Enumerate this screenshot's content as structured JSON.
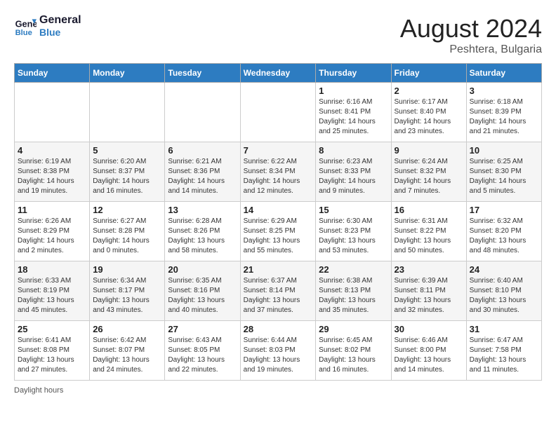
{
  "header": {
    "logo_line1": "General",
    "logo_line2": "Blue",
    "month_year": "August 2024",
    "location": "Peshtera, Bulgaria"
  },
  "days_of_week": [
    "Sunday",
    "Monday",
    "Tuesday",
    "Wednesday",
    "Thursday",
    "Friday",
    "Saturday"
  ],
  "weeks": [
    [
      {
        "day": "",
        "sunrise": "",
        "sunset": "",
        "daylight": ""
      },
      {
        "day": "",
        "sunrise": "",
        "sunset": "",
        "daylight": ""
      },
      {
        "day": "",
        "sunrise": "",
        "sunset": "",
        "daylight": ""
      },
      {
        "day": "",
        "sunrise": "",
        "sunset": "",
        "daylight": ""
      },
      {
        "day": "1",
        "sunrise": "Sunrise: 6:16 AM",
        "sunset": "Sunset: 8:41 PM",
        "daylight": "Daylight: 14 hours and 25 minutes."
      },
      {
        "day": "2",
        "sunrise": "Sunrise: 6:17 AM",
        "sunset": "Sunset: 8:40 PM",
        "daylight": "Daylight: 14 hours and 23 minutes."
      },
      {
        "day": "3",
        "sunrise": "Sunrise: 6:18 AM",
        "sunset": "Sunset: 8:39 PM",
        "daylight": "Daylight: 14 hours and 21 minutes."
      }
    ],
    [
      {
        "day": "4",
        "sunrise": "Sunrise: 6:19 AM",
        "sunset": "Sunset: 8:38 PM",
        "daylight": "Daylight: 14 hours and 19 minutes."
      },
      {
        "day": "5",
        "sunrise": "Sunrise: 6:20 AM",
        "sunset": "Sunset: 8:37 PM",
        "daylight": "Daylight: 14 hours and 16 minutes."
      },
      {
        "day": "6",
        "sunrise": "Sunrise: 6:21 AM",
        "sunset": "Sunset: 8:36 PM",
        "daylight": "Daylight: 14 hours and 14 minutes."
      },
      {
        "day": "7",
        "sunrise": "Sunrise: 6:22 AM",
        "sunset": "Sunset: 8:34 PM",
        "daylight": "Daylight: 14 hours and 12 minutes."
      },
      {
        "day": "8",
        "sunrise": "Sunrise: 6:23 AM",
        "sunset": "Sunset: 8:33 PM",
        "daylight": "Daylight: 14 hours and 9 minutes."
      },
      {
        "day": "9",
        "sunrise": "Sunrise: 6:24 AM",
        "sunset": "Sunset: 8:32 PM",
        "daylight": "Daylight: 14 hours and 7 minutes."
      },
      {
        "day": "10",
        "sunrise": "Sunrise: 6:25 AM",
        "sunset": "Sunset: 8:30 PM",
        "daylight": "Daylight: 14 hours and 5 minutes."
      }
    ],
    [
      {
        "day": "11",
        "sunrise": "Sunrise: 6:26 AM",
        "sunset": "Sunset: 8:29 PM",
        "daylight": "Daylight: 14 hours and 2 minutes."
      },
      {
        "day": "12",
        "sunrise": "Sunrise: 6:27 AM",
        "sunset": "Sunset: 8:28 PM",
        "daylight": "Daylight: 14 hours and 0 minutes."
      },
      {
        "day": "13",
        "sunrise": "Sunrise: 6:28 AM",
        "sunset": "Sunset: 8:26 PM",
        "daylight": "Daylight: 13 hours and 58 minutes."
      },
      {
        "day": "14",
        "sunrise": "Sunrise: 6:29 AM",
        "sunset": "Sunset: 8:25 PM",
        "daylight": "Daylight: 13 hours and 55 minutes."
      },
      {
        "day": "15",
        "sunrise": "Sunrise: 6:30 AM",
        "sunset": "Sunset: 8:23 PM",
        "daylight": "Daylight: 13 hours and 53 minutes."
      },
      {
        "day": "16",
        "sunrise": "Sunrise: 6:31 AM",
        "sunset": "Sunset: 8:22 PM",
        "daylight": "Daylight: 13 hours and 50 minutes."
      },
      {
        "day": "17",
        "sunrise": "Sunrise: 6:32 AM",
        "sunset": "Sunset: 8:20 PM",
        "daylight": "Daylight: 13 hours and 48 minutes."
      }
    ],
    [
      {
        "day": "18",
        "sunrise": "Sunrise: 6:33 AM",
        "sunset": "Sunset: 8:19 PM",
        "daylight": "Daylight: 13 hours and 45 minutes."
      },
      {
        "day": "19",
        "sunrise": "Sunrise: 6:34 AM",
        "sunset": "Sunset: 8:17 PM",
        "daylight": "Daylight: 13 hours and 43 minutes."
      },
      {
        "day": "20",
        "sunrise": "Sunrise: 6:35 AM",
        "sunset": "Sunset: 8:16 PM",
        "daylight": "Daylight: 13 hours and 40 minutes."
      },
      {
        "day": "21",
        "sunrise": "Sunrise: 6:37 AM",
        "sunset": "Sunset: 8:14 PM",
        "daylight": "Daylight: 13 hours and 37 minutes."
      },
      {
        "day": "22",
        "sunrise": "Sunrise: 6:38 AM",
        "sunset": "Sunset: 8:13 PM",
        "daylight": "Daylight: 13 hours and 35 minutes."
      },
      {
        "day": "23",
        "sunrise": "Sunrise: 6:39 AM",
        "sunset": "Sunset: 8:11 PM",
        "daylight": "Daylight: 13 hours and 32 minutes."
      },
      {
        "day": "24",
        "sunrise": "Sunrise: 6:40 AM",
        "sunset": "Sunset: 8:10 PM",
        "daylight": "Daylight: 13 hours and 30 minutes."
      }
    ],
    [
      {
        "day": "25",
        "sunrise": "Sunrise: 6:41 AM",
        "sunset": "Sunset: 8:08 PM",
        "daylight": "Daylight: 13 hours and 27 minutes."
      },
      {
        "day": "26",
        "sunrise": "Sunrise: 6:42 AM",
        "sunset": "Sunset: 8:07 PM",
        "daylight": "Daylight: 13 hours and 24 minutes."
      },
      {
        "day": "27",
        "sunrise": "Sunrise: 6:43 AM",
        "sunset": "Sunset: 8:05 PM",
        "daylight": "Daylight: 13 hours and 22 minutes."
      },
      {
        "day": "28",
        "sunrise": "Sunrise: 6:44 AM",
        "sunset": "Sunset: 8:03 PM",
        "daylight": "Daylight: 13 hours and 19 minutes."
      },
      {
        "day": "29",
        "sunrise": "Sunrise: 6:45 AM",
        "sunset": "Sunset: 8:02 PM",
        "daylight": "Daylight: 13 hours and 16 minutes."
      },
      {
        "day": "30",
        "sunrise": "Sunrise: 6:46 AM",
        "sunset": "Sunset: 8:00 PM",
        "daylight": "Daylight: 13 hours and 14 minutes."
      },
      {
        "day": "31",
        "sunrise": "Sunrise: 6:47 AM",
        "sunset": "Sunset: 7:58 PM",
        "daylight": "Daylight: 13 hours and 11 minutes."
      }
    ]
  ],
  "footer": {
    "note": "Daylight hours"
  }
}
